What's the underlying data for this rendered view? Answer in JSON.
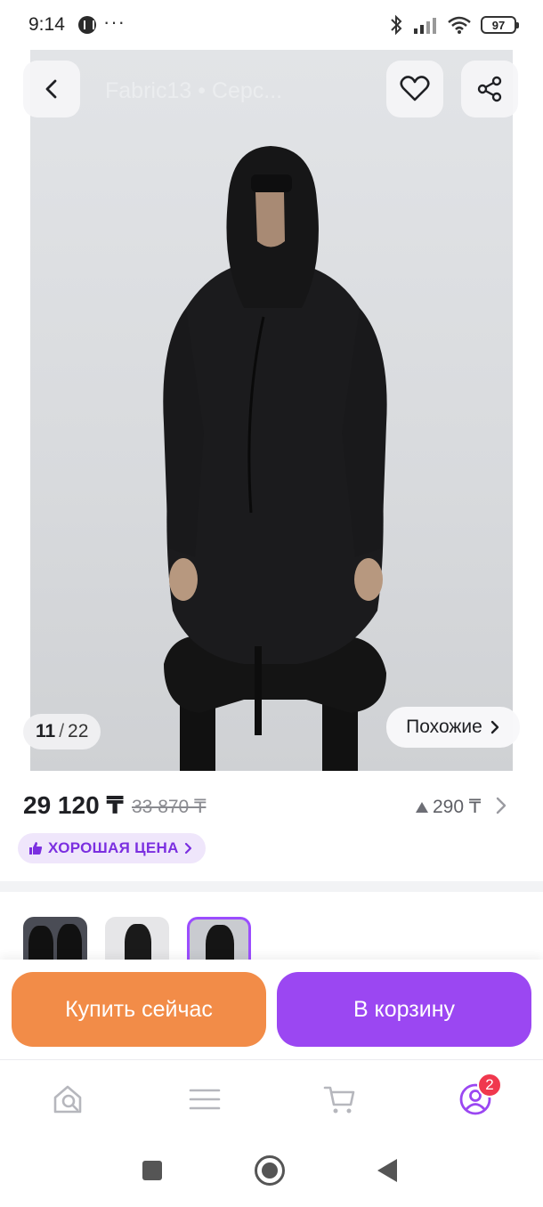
{
  "status_bar": {
    "time": "9:14",
    "more": "···",
    "battery": "97"
  },
  "hero": {
    "title": "Fabric13 • Серс...",
    "counter_current": "11",
    "counter_separator": "/",
    "counter_total": "22",
    "similar_label": "Похожие",
    "icons": [
      "back-icon",
      "heart-icon",
      "share-icon",
      "chevron-right-icon"
    ]
  },
  "price": {
    "current": "29 120 ₸",
    "old": "33 870 ₸",
    "bonus": "290 ₸",
    "good_price_label": "ХОРОШАЯ ЦЕНА"
  },
  "actions": {
    "buy_now": "Купить сейчас",
    "add_to_cart": "В корзину"
  },
  "bottom_nav": {
    "items": [
      "home-search-icon",
      "catalog-icon",
      "cart-icon",
      "profile-icon"
    ],
    "profile_badge": "2"
  },
  "colors": {
    "accent_purple": "#9b47f2",
    "accent_orange": "#f28c48",
    "badge_red": "#f0384e"
  }
}
